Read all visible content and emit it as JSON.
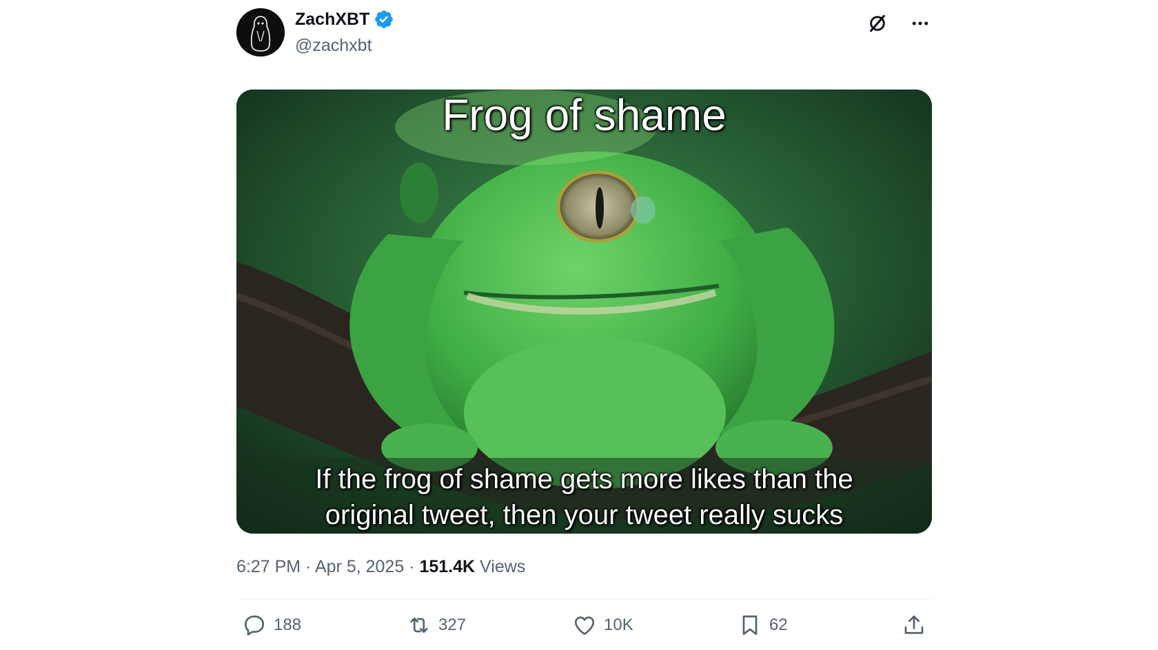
{
  "author": {
    "display_name": "ZachXBT",
    "handle": "@zachxbt",
    "verified": true,
    "verified_color": "#1d9bf0"
  },
  "header_actions": {
    "grok_icon": "grok-icon",
    "more_icon": "more-icon"
  },
  "media": {
    "caption_top": "Frog of shame",
    "caption_bottom_line1": "If the frog of shame gets more likes than the",
    "caption_bottom_line2": "original tweet, then your tweet really sucks"
  },
  "meta": {
    "time": "6:27 PM",
    "separator": "·",
    "date": "Apr 5, 2025",
    "views_count": "151.4K",
    "views_label": "Views"
  },
  "actions": {
    "replies": "188",
    "reposts": "327",
    "likes": "10K",
    "bookmarks": "62"
  },
  "colors": {
    "text_primary": "#0f1419",
    "text_secondary": "#536471",
    "divider": "#eff3f4"
  }
}
